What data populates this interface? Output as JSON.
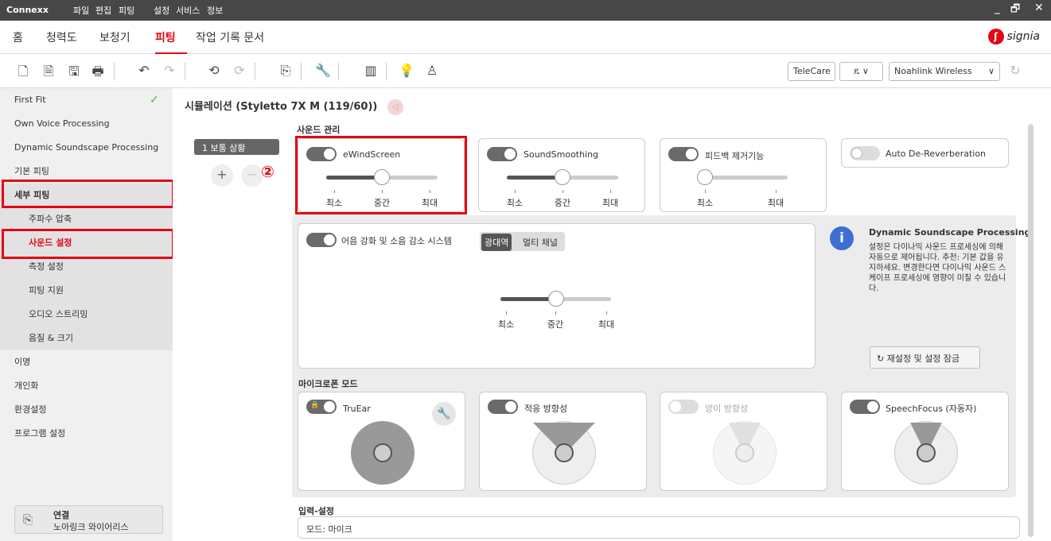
{
  "titlebar": {
    "app": "Connexx",
    "menus": [
      "파일",
      "편집",
      "피팅",
      "설정",
      "서비스",
      "정보"
    ],
    "minimize": "_",
    "restore": "🗗",
    "close": "✕"
  },
  "nav": {
    "items": [
      "홈",
      "청력도",
      "보청기",
      "피팅",
      "작업 기록 문서"
    ],
    "active_index": 3,
    "brand": "signia",
    "brand_mark": "ʃ"
  },
  "toolbar": {
    "telecare": "TeleCare",
    "user_icon": "ዴ",
    "user_chevron": "∨",
    "device": "Noahlink Wireless",
    "device_chevron": "∨",
    "refresh": "↻"
  },
  "sidebar": {
    "items": [
      {
        "label": "First Fit",
        "checked": true
      },
      {
        "label": "Own Voice Processing"
      },
      {
        "label": "Dynamic Soundscape Processing"
      },
      {
        "label": "기본 피팅"
      },
      {
        "label": "세부 피팅"
      },
      {
        "label": "주파수 압축"
      },
      {
        "label": "사운드 설정"
      },
      {
        "label": "측정 설정"
      },
      {
        "label": "피팅 지원"
      },
      {
        "label": "오디오 스트리밍"
      },
      {
        "label": "음질 & 크기"
      },
      {
        "label": "이명"
      },
      {
        "label": "개인화"
      },
      {
        "label": "환경설정"
      },
      {
        "label": "프로그램 설정"
      }
    ],
    "check": "✓",
    "connect_title": "연결",
    "connect_sub": "노아링크 와이어리스"
  },
  "main": {
    "title": "시뮬레이션 (Styletto 7X M (119/60))",
    "program_tab": "1 보통 상황",
    "add_button": "+",
    "remove_button": "−",
    "annotation_marker": "②",
    "sound_section": "사운드 관리",
    "cards": [
      {
        "label": "eWindScreen",
        "on": true,
        "level": 0.5
      },
      {
        "label": "SoundSmoothing",
        "on": true,
        "level": 0.5
      },
      {
        "label": "피드백 제거기능",
        "on": true,
        "level": 0.0
      },
      {
        "label": "Auto De-Reverberation",
        "on": false
      }
    ],
    "scale3": [
      "최소",
      "중간",
      "최대"
    ],
    "scale2": [
      "최소",
      "최대"
    ],
    "speech": {
      "label": "어음 강화 및 소음 감소 시스템",
      "on": true,
      "tabs": [
        "광대역",
        "멀티 채널"
      ],
      "active_tab": 0,
      "level": 0.5
    },
    "info": {
      "icon": "i",
      "title": "Dynamic Soundscape Processing",
      "body": "설정은 다이나믹 사운드 프로세싱에 의해 자동으로 제어됩니다. 추천: 기본 값을 유지하세요. 변경한다면 다이나믹 사운드 스케이프 프로세싱에 영향이 미칠 수 있습니다.",
      "reset_button": "재설정 및 설정 잠금",
      "reset_icon": "↻"
    },
    "mic_section": "마이크로폰 모드",
    "mic_cards": [
      {
        "label": "TruEar",
        "on": true,
        "locked": true
      },
      {
        "label": "적응 방향성",
        "on": true
      },
      {
        "label": "양이 방향성",
        "on": false,
        "locked": true
      },
      {
        "label": "SpeechFocus (자동자)",
        "on": true
      }
    ],
    "input_section": "입력-설정",
    "input_mode": "모드: 마이크"
  },
  "colors": {
    "accent": "#e30613",
    "info": "#3b6fd4"
  }
}
